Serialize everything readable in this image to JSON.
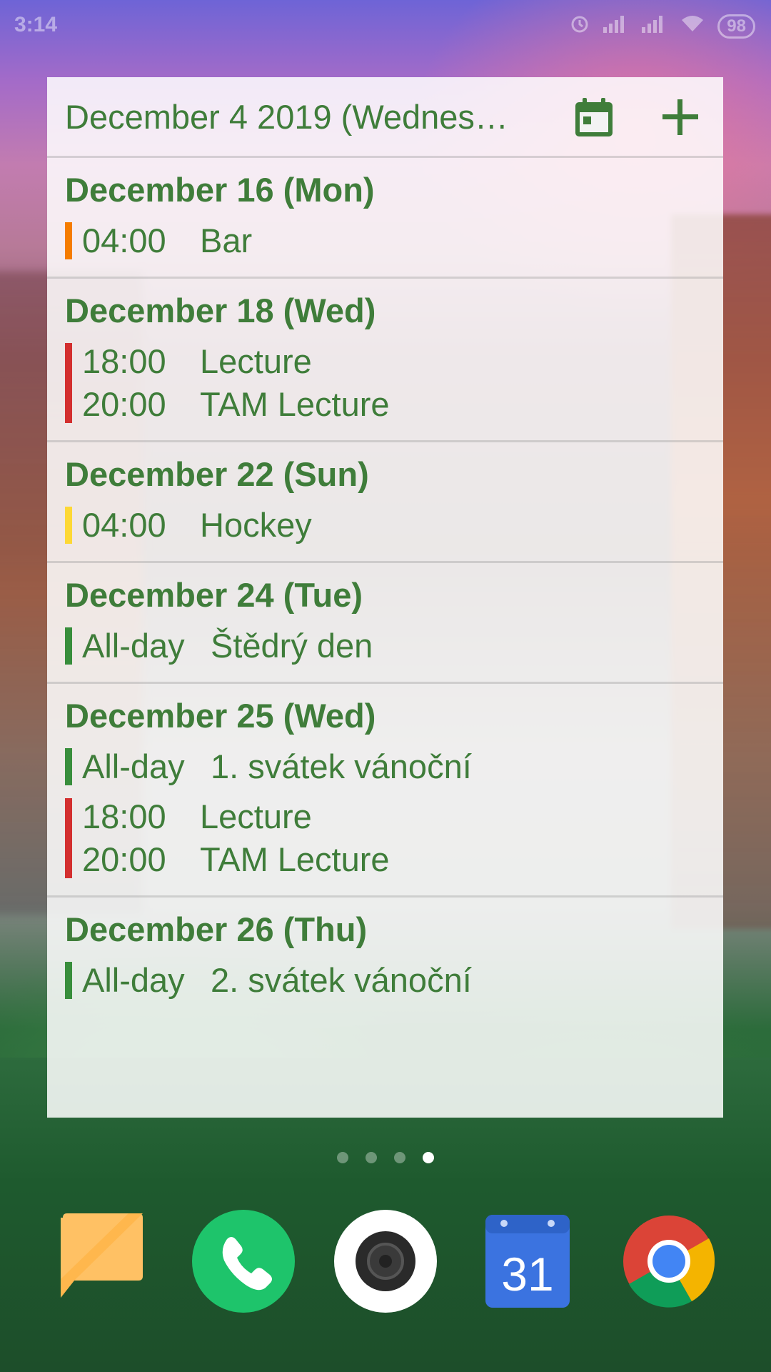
{
  "status_bar": {
    "time": "3:14",
    "battery": "98",
    "icons": [
      "alarm-icon",
      "signal-icon",
      "signal-icon",
      "wifi-icon",
      "battery-icon"
    ]
  },
  "widget": {
    "header_date": "December 4 2019 (Wednes…",
    "buttons": [
      "calendar-icon",
      "add-icon"
    ],
    "accent_color": "#3f7d3a",
    "days": [
      {
        "title": "December 16 (Mon)",
        "groups": [
          {
            "color": "#f57c00",
            "events": [
              {
                "time": "04:00",
                "title": "Bar"
              }
            ]
          }
        ]
      },
      {
        "title": "December 18 (Wed)",
        "groups": [
          {
            "color": "#d32f2f",
            "events": [
              {
                "time": "18:00",
                "title": "Lecture"
              },
              {
                "time": "20:00",
                "title": "TAM Lecture"
              }
            ]
          }
        ]
      },
      {
        "title": "December 22 (Sun)",
        "groups": [
          {
            "color": "#fdd835",
            "events": [
              {
                "time": "04:00",
                "title": "Hockey"
              }
            ]
          }
        ]
      },
      {
        "title": "December 24 (Tue)",
        "groups": [
          {
            "color": "#388e3c",
            "events": [
              {
                "time": "All-day",
                "title": "Štědrý den"
              }
            ]
          }
        ]
      },
      {
        "title": "December 25 (Wed)",
        "groups": [
          {
            "color": "#388e3c",
            "events": [
              {
                "time": "All-day",
                "title": "1. svátek vánoční"
              }
            ]
          },
          {
            "color": "#d32f2f",
            "events": [
              {
                "time": "18:00",
                "title": "Lecture"
              },
              {
                "time": "20:00",
                "title": "TAM Lecture"
              }
            ]
          }
        ]
      },
      {
        "title": "December 26 (Thu)",
        "groups": [
          {
            "color": "#388e3c",
            "events": [
              {
                "time": "All-day",
                "title": "2. svátek vánoční"
              }
            ]
          }
        ]
      }
    ]
  },
  "home": {
    "page_count": 4,
    "active_page": 4,
    "dock": [
      {
        "name": "notes-app-icon",
        "color": "#ffb74d"
      },
      {
        "name": "phone-app-icon",
        "color": "#1ec46b"
      },
      {
        "name": "camera-app-icon",
        "color": "#ffffff"
      },
      {
        "name": "calendar-app-icon",
        "color": "#3b73e0",
        "label": "31"
      },
      {
        "name": "chrome-app-icon",
        "color": "#4285f4"
      }
    ]
  }
}
